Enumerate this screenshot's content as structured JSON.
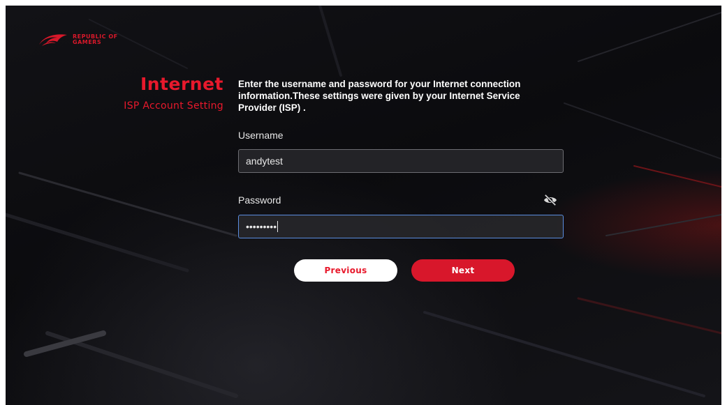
{
  "brand": {
    "logo_text": "REPUBLIC OF\nGAMERS",
    "accent_color": "#e8192c"
  },
  "sidebar": {
    "title": "Internet",
    "subtitle": "ISP Account Setting"
  },
  "form": {
    "description": "Enter the username and password for your Internet connection information.These settings were given by your Internet Service Provider (ISP) .",
    "username_label": "Username",
    "username_value": "andytest",
    "password_label": "Password",
    "password_masked": "•••••••••",
    "password_visibility_icon": "eye-off-icon"
  },
  "buttons": {
    "previous_label": "Previous",
    "next_label": "Next"
  }
}
